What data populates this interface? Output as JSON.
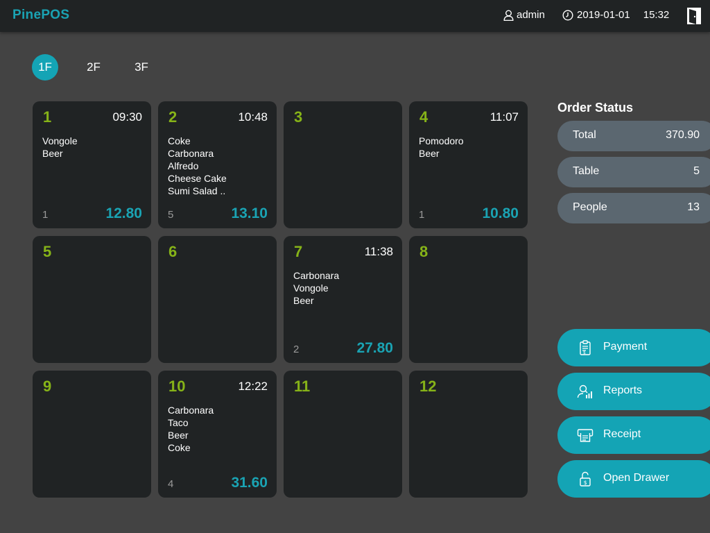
{
  "app": {
    "logo": "PinePOS",
    "user": "admin",
    "date": "2019-01-01",
    "time": "15:32"
  },
  "floors": [
    {
      "label": "1F",
      "active": true
    },
    {
      "label": "2F",
      "active": false
    },
    {
      "label": "3F",
      "active": false
    }
  ],
  "tables": [
    {
      "number": "1",
      "time": "09:30",
      "items": [
        "Vongole",
        "Beer"
      ],
      "guests": "1",
      "amount": "12.80"
    },
    {
      "number": "2",
      "time": "10:48",
      "items": [
        "Coke",
        "Carbonara",
        "Alfredo",
        "Cheese Cake",
        "Sumi Salad .."
      ],
      "guests": "5",
      "amount": "13.10"
    },
    {
      "number": "3",
      "time": "",
      "items": [],
      "guests": "",
      "amount": ""
    },
    {
      "number": "4",
      "time": "11:07",
      "items": [
        "Pomodoro",
        "Beer"
      ],
      "guests": "1",
      "amount": "10.80"
    },
    {
      "number": "5",
      "time": "",
      "items": [],
      "guests": "",
      "amount": ""
    },
    {
      "number": "6",
      "time": "",
      "items": [],
      "guests": "",
      "amount": ""
    },
    {
      "number": "7",
      "time": "11:38",
      "items": [
        "Carbonara",
        "Vongole",
        "Beer"
      ],
      "guests": "2",
      "amount": "27.80"
    },
    {
      "number": "8",
      "time": "",
      "items": [],
      "guests": "",
      "amount": ""
    },
    {
      "number": "9",
      "time": "",
      "items": [],
      "guests": "",
      "amount": ""
    },
    {
      "number": "10",
      "time": "12:22",
      "items": [
        "Carbonara",
        "Taco",
        "Beer",
        "Coke"
      ],
      "guests": "4",
      "amount": "31.60"
    },
    {
      "number": "11",
      "time": "",
      "items": [],
      "guests": "",
      "amount": ""
    },
    {
      "number": "12",
      "time": "",
      "items": [],
      "guests": "",
      "amount": ""
    }
  ],
  "order_status": {
    "title": "Order Status",
    "rows": [
      {
        "label": "Total",
        "value": "370.90"
      },
      {
        "label": "Table",
        "value": "5"
      },
      {
        "label": "People",
        "value": "13"
      }
    ]
  },
  "actions": [
    {
      "label": "Payment",
      "icon": "clipboard-icon"
    },
    {
      "label": "Reports",
      "icon": "reports-icon"
    },
    {
      "label": "Receipt",
      "icon": "receipt-printer-icon"
    },
    {
      "label": "Open Drawer",
      "icon": "lock-open-icon"
    }
  ],
  "colors": {
    "background": "#434343",
    "panel": "#202324",
    "accent": "#14a4b5",
    "table_number": "#86b318",
    "status_pill": "#5b6770"
  }
}
